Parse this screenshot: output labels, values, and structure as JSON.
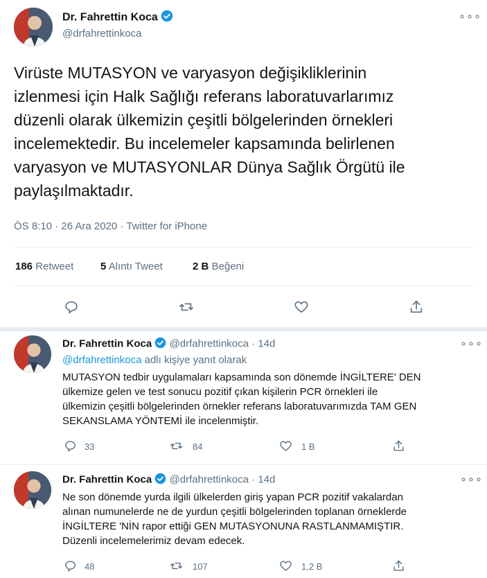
{
  "main_tweet": {
    "author_name": "Dr. Fahrettin Koca",
    "handle": "@drfahrettinkoca",
    "text_lines": [
      "Virüste MUTASYON ve varyasyon değişikliklerinin",
      "izlenmesi için Halk Sağlığı referans laboratuvarlarımız",
      "düzenli olarak ülkemizin çeşitli bölgelerinden örnekleri",
      "incelemektedir. Bu incelemeler kapsamında belirlenen",
      "varyasyon ve MUTASYONLAR Dünya Sağlık Örgütü ile",
      "paylaşılmaktadır."
    ],
    "meta": "ÖS 8:10 · 26 Ara 2020 · Twitter for iPhone",
    "retweets_count": "186",
    "retweets_label": "Retweet",
    "quotes_count": "5",
    "quotes_label": "Alıntı Tweet",
    "likes_count": "2 B",
    "likes_label": "Beğeni",
    "icons": [
      "reply-icon",
      "retweet-icon",
      "like-icon",
      "share-icon"
    ]
  },
  "replies": [
    {
      "author_name": "Dr. Fahrettin Koca",
      "handle": "@drfahrettinkoca",
      "time": "· 14d",
      "reply_to_handle": "@drfahrettinkoca",
      "reply_to_suffix": "adlı kişiye yanıt olarak",
      "text_lines": [
        "MUTASYON tedbir uygulamaları kapsamında son dönemde İNGİLTERE' DEN",
        "ülkemize gelen ve test sonucu pozitif çıkan kişilerin PCR örnekleri ile",
        "ülkemizin çeşitli bölgelerinden örnekler referans laboratuvarımızda TAM GEN",
        "SEKANSLAMA YÖNTEMİ ile incelenmiştir."
      ],
      "reply_count": "33",
      "retweet_count": "84",
      "like_count": "1 B"
    },
    {
      "author_name": "Dr. Fahrettin Koca",
      "handle": "@drfahrettinkoca",
      "time": "· 14d",
      "text_lines": [
        "Ne son dönemde yurda ilgili ülkelerden giriş yapan PCR pozitif vakalardan",
        "alınan numunelerde ne de yurdun çeşitli bölgelerinden toplanan örneklerde",
        "İNGİLTERE 'NİN rapor ettiği GEN MUTASYONUNA  RASTLANMAMIŞTIR.",
        "Düzenli incelemelerimiz devam edecek."
      ],
      "reply_count": "48",
      "retweet_count": "107",
      "like_count": "1,2 B"
    }
  ],
  "colors": {
    "accent": "#1b95e0",
    "muted": "#5b7083",
    "divider": "#e6ecf0",
    "text": "#0f1419"
  }
}
